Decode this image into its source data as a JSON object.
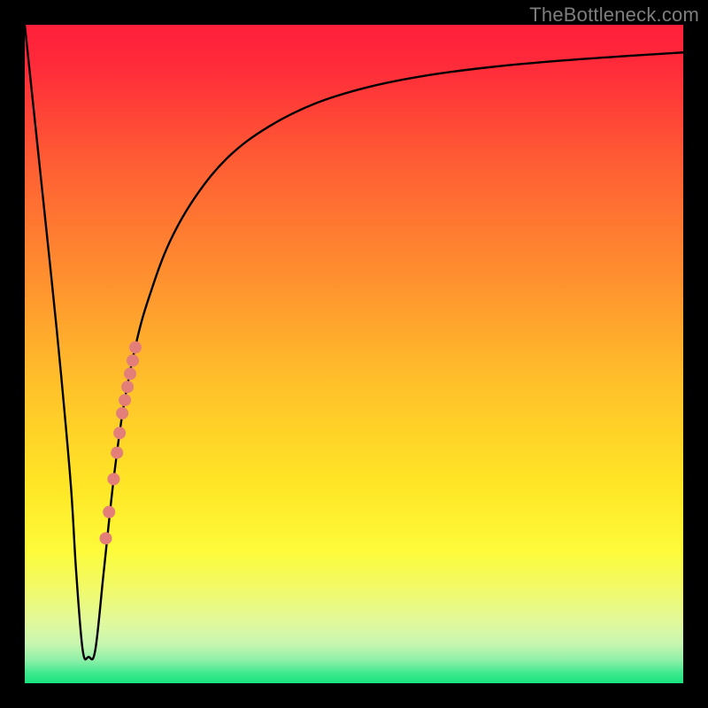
{
  "watermark": "TheBottleneck.com",
  "chart_data": {
    "type": "line",
    "title": "",
    "xlabel": "",
    "ylabel": "",
    "xlim": [
      0,
      100
    ],
    "ylim": [
      0,
      100
    ],
    "background_gradient": {
      "stops": [
        {
          "offset": 0.0,
          "color": "#ff1f3a"
        },
        {
          "offset": 0.06,
          "color": "#ff2a3a"
        },
        {
          "offset": 0.2,
          "color": "#ff5a34"
        },
        {
          "offset": 0.38,
          "color": "#ff8f2f"
        },
        {
          "offset": 0.55,
          "color": "#ffc22a"
        },
        {
          "offset": 0.7,
          "color": "#ffe626"
        },
        {
          "offset": 0.8,
          "color": "#fdfb3a"
        },
        {
          "offset": 0.86,
          "color": "#f0fa6c"
        },
        {
          "offset": 0.905,
          "color": "#e2f99a"
        },
        {
          "offset": 0.94,
          "color": "#c8f6b0"
        },
        {
          "offset": 0.965,
          "color": "#8ef0a8"
        },
        {
          "offset": 0.985,
          "color": "#3de88e"
        },
        {
          "offset": 1.0,
          "color": "#17e47e"
        }
      ]
    },
    "series": [
      {
        "name": "bottleneck-curve",
        "color": "#000000",
        "stroke_width": 2.4,
        "x": [
          0,
          2,
          4,
          5.5,
          7.0,
          7.8,
          8.8,
          9.7,
          10.7,
          12.0,
          13.5,
          15.0,
          17.0,
          19.0,
          22.0,
          26.0,
          31.0,
          37.0,
          44.0,
          52.0,
          61.0,
          71.0,
          82.0,
          92.0,
          100.0
        ],
        "y": [
          100,
          81,
          62,
          47,
          30,
          17,
          5,
          4,
          5,
          17,
          31,
          42,
          52,
          59,
          67,
          74,
          80,
          84.5,
          88,
          90.5,
          92.3,
          93.6,
          94.6,
          95.3,
          95.8
        ]
      }
    ],
    "markers": [
      {
        "name": "highlight-dots",
        "color": "#e37f78",
        "radius": 7,
        "points": [
          {
            "x": 12.3,
            "y": 22
          },
          {
            "x": 12.8,
            "y": 26
          },
          {
            "x": 13.5,
            "y": 31
          },
          {
            "x": 14.0,
            "y": 35
          },
          {
            "x": 14.4,
            "y": 38
          },
          {
            "x": 14.8,
            "y": 41
          },
          {
            "x": 15.2,
            "y": 43
          },
          {
            "x": 15.6,
            "y": 45
          },
          {
            "x": 16.0,
            "y": 47
          },
          {
            "x": 16.4,
            "y": 49
          },
          {
            "x": 16.8,
            "y": 51
          }
        ]
      }
    ]
  }
}
